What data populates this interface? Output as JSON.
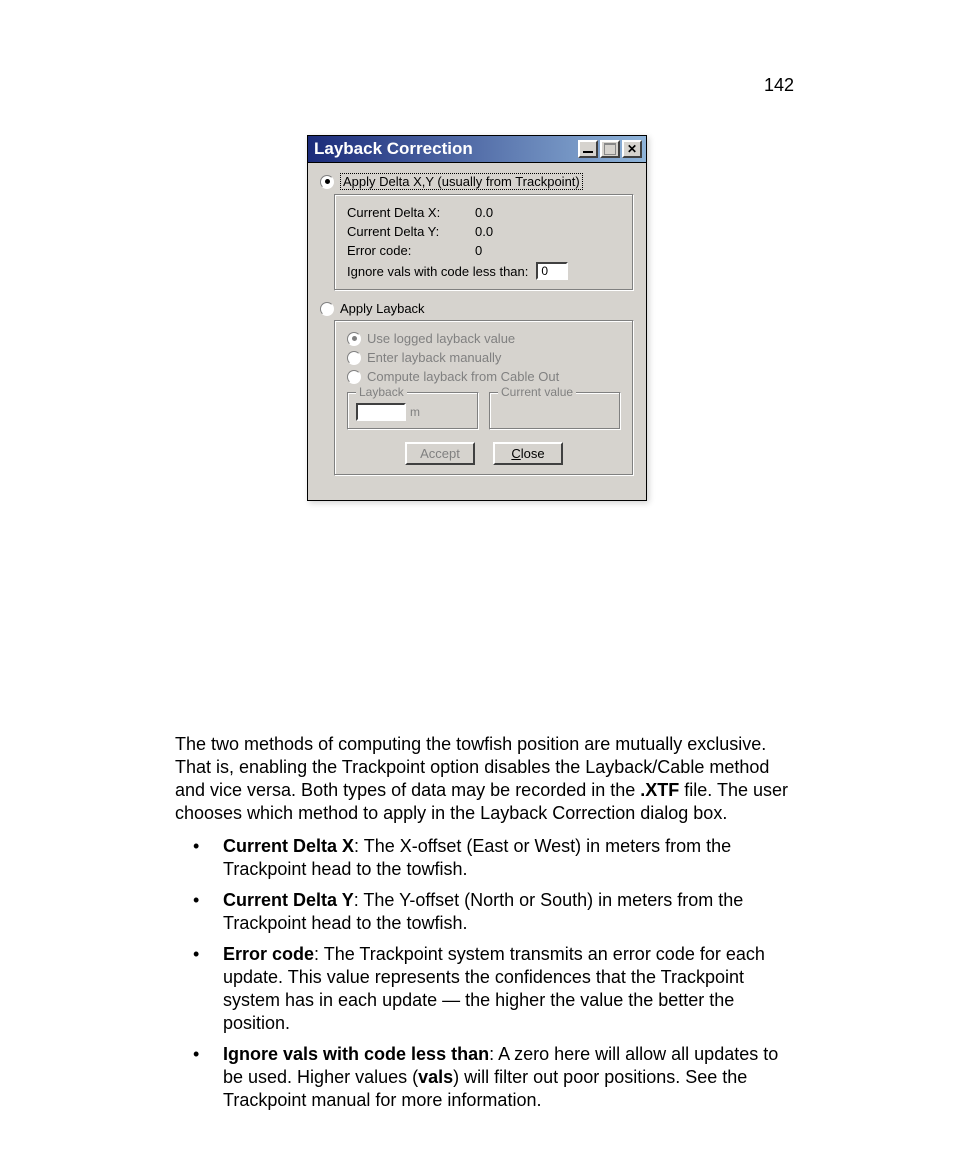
{
  "page_number": "142",
  "dialog": {
    "title": "Layback Correction",
    "option1_label": "Apply Delta X,Y (usually from Trackpoint)",
    "delta_x_label": "Current Delta X:",
    "delta_x_value": "0.0",
    "delta_y_label": "Current Delta Y:",
    "delta_y_value": "0.0",
    "error_code_label": "Error code:",
    "error_code_value": "0",
    "ignore_label": "Ignore vals with code less than:",
    "ignore_value": "0",
    "option2_label": "Apply Layback",
    "sub_use_logged": "Use logged layback value",
    "sub_enter_manual": "Enter layback manually",
    "sub_compute": "Compute layback from Cable Out",
    "gb_layback_legend": "Layback",
    "gb_layback_unit": "m",
    "gb_current_legend": "Current value",
    "btn_accept": "Accept",
    "btn_close_c": "C",
    "btn_close_rest": "lose"
  },
  "paragraph": {
    "p1_a": "The two methods of computing the towfish position are mutually exclusive. That is, enabling the Trackpoint option disables the Layback/Cable method and vice versa. Both types of data may be recorded in the ",
    "p1_bold": ".XTF",
    "p1_b": " file. The user chooses which method to apply in the Layback Correction dialog box."
  },
  "bullets": {
    "b1_bold": "Current Delta X",
    "b1_text": ": The X-offset (East or West) in meters from the Trackpoint head to the towfish.",
    "b2_bold": "Current Delta Y",
    "b2_text": ": The Y-offset (North or South) in meters from the Trackpoint head to the towfish.",
    "b3_bold": "Error code",
    "b3_text": ": The Trackpoint system transmits an error code for each update. This value represents the confidences that the Trackpoint system has in each update — the higher the value the better the position.",
    "b4_bold": "Ignore vals with code less than",
    "b4_text_a": ": A zero here will allow all updates to be used. Higher values (",
    "b4_vals": "vals",
    "b4_text_b": ") will filter out poor positions. See the Trackpoint manual for more information."
  }
}
